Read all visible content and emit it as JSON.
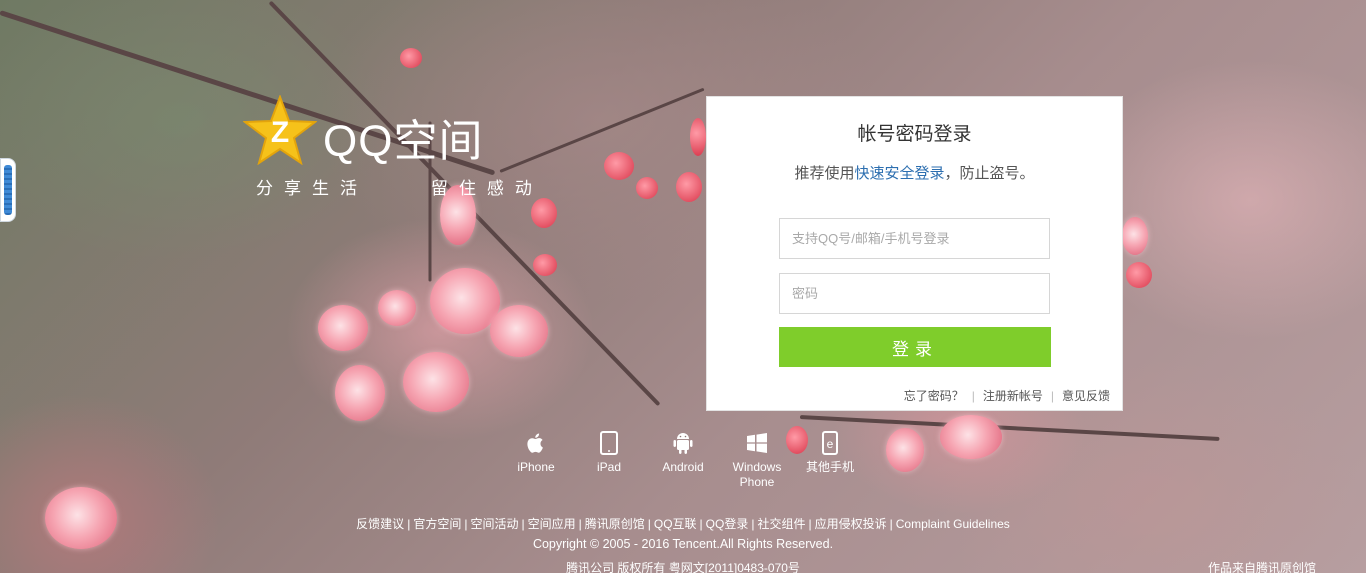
{
  "logo": {
    "name": "QQ空间",
    "slogan": "分享生活    留住感动"
  },
  "login": {
    "title": "帐号密码登录",
    "tip_prefix": "推荐使用",
    "tip_link": "快速安全登录",
    "tip_suffix": "，防止盗号。",
    "username_placeholder": "支持QQ号/邮箱/手机号登录",
    "password_placeholder": "密码",
    "submit_label": "登录",
    "links": [
      "忘了密码？",
      "注册新帐号",
      "意见反馈"
    ]
  },
  "platforms": [
    {
      "label": "iPhone",
      "icon": "apple-icon"
    },
    {
      "label": "iPad",
      "icon": "tablet-icon"
    },
    {
      "label": "Android",
      "icon": "android-icon"
    },
    {
      "label": "Windows Phone",
      "icon": "windows-icon"
    },
    {
      "label": "其他手机",
      "icon": "phone-e-icon"
    }
  ],
  "footer": {
    "links": [
      "反馈建议",
      "官方空间",
      "空间活动",
      "空间应用",
      "腾讯原创馆",
      "QQ互联",
      "QQ登录",
      "社交组件",
      "应用侵权投诉",
      "Complaint Guidelines"
    ],
    "copyright": "Copyright © 2005 - 2016 Tencent.All Rights Reserved.",
    "icp": "腾讯公司 版权所有 粤网文[2011]0483-070号",
    "photo_credit": "作品来自腾讯原创馆"
  },
  "colors": {
    "login_button": "#7fcd2b",
    "tip_link": "#2d6fb0",
    "logo_star": "#f6c21a"
  }
}
